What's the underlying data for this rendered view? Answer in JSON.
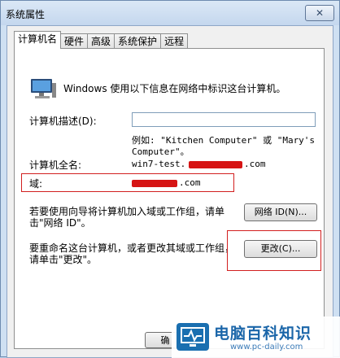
{
  "window": {
    "title": "系统属性",
    "close_label": "✕"
  },
  "tabs": [
    "计算机名",
    "硬件",
    "高级",
    "系统保护",
    "远程"
  ],
  "intro": "Windows 使用以下信息在网络中标识这台计算机。",
  "description": {
    "label": "计算机描述(D):",
    "value": "",
    "example_line1": "例如: \"Kitchen Computer\" 或 \"Mary's",
    "example_line2": "Computer\"。"
  },
  "full_name": {
    "label": "计算机全名:",
    "value": "win7-test.",
    "value_suffix": ".com"
  },
  "domain": {
    "label": "域:",
    "value_suffix": ".com"
  },
  "network_id": {
    "text_line1": "若要使用向导将计算机加入域或工作组，请单",
    "text_line2": "击\"网络 ID\"。",
    "button": "网络 ID(N)..."
  },
  "rename": {
    "text_line1": "要重命名这台计算机，或者更改其域或工作组，",
    "text_line2": "请单击\"更改\"。",
    "button": "更改(C)..."
  },
  "footer": {
    "ok_label": "确"
  },
  "watermark": {
    "text": "电脑百科知识",
    "url": "www.pc-daily.com"
  }
}
